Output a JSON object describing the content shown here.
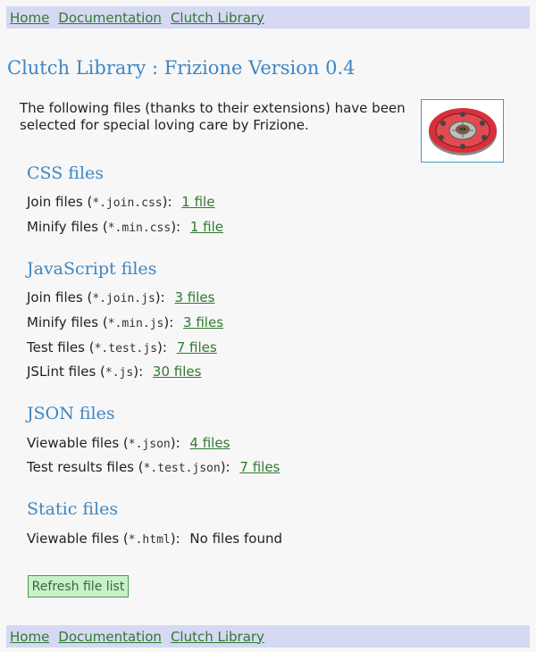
{
  "nav": {
    "home": "Home",
    "documentation": "Documentation",
    "clutch_library": "Clutch Library"
  },
  "page": {
    "title": "Clutch Library : Frizione Version 0.4",
    "intro": "The following files (thanks to their extensions) have been selected for special loving care by Frizione."
  },
  "logo": {
    "icon": "clutch-plate-icon"
  },
  "sections": {
    "css": {
      "heading": "CSS files",
      "rows": [
        {
          "label": "Join files (",
          "ext": "*.join.css",
          "suffix": "):",
          "link": "1 file"
        },
        {
          "label": "Minify files (",
          "ext": "*.min.css",
          "suffix": "):",
          "link": "1 file"
        }
      ]
    },
    "js": {
      "heading": "JavaScript files",
      "rows": [
        {
          "label": "Join files (",
          "ext": "*.join.js",
          "suffix": "):",
          "link": "3 files"
        },
        {
          "label": "Minify files (",
          "ext": "*.min.js",
          "suffix": "):",
          "link": "3 files"
        },
        {
          "label": "Test files (",
          "ext": "*.test.js",
          "suffix": "):",
          "link": "7 files"
        },
        {
          "label": "JSLint files (",
          "ext": "*.js",
          "suffix": "):",
          "link": "30 files"
        }
      ]
    },
    "json": {
      "heading": "JSON files",
      "rows": [
        {
          "label": "Viewable files (",
          "ext": "*.json",
          "suffix": "):",
          "link": "4 files"
        },
        {
          "label": "Test results files (",
          "ext": "*.test.json",
          "suffix": "):",
          "link": "7 files"
        }
      ]
    },
    "static": {
      "heading": "Static files",
      "rows": [
        {
          "label": "Viewable files (",
          "ext": "*.html",
          "suffix": "):",
          "status": "No files found"
        }
      ]
    }
  },
  "buttons": {
    "refresh": "Refresh file list"
  },
  "colors": {
    "nav_bg": "#d6d9f3",
    "link": "#2f7a2f",
    "heading": "#3f86c4",
    "button_bg": "#c9f0c9"
  }
}
